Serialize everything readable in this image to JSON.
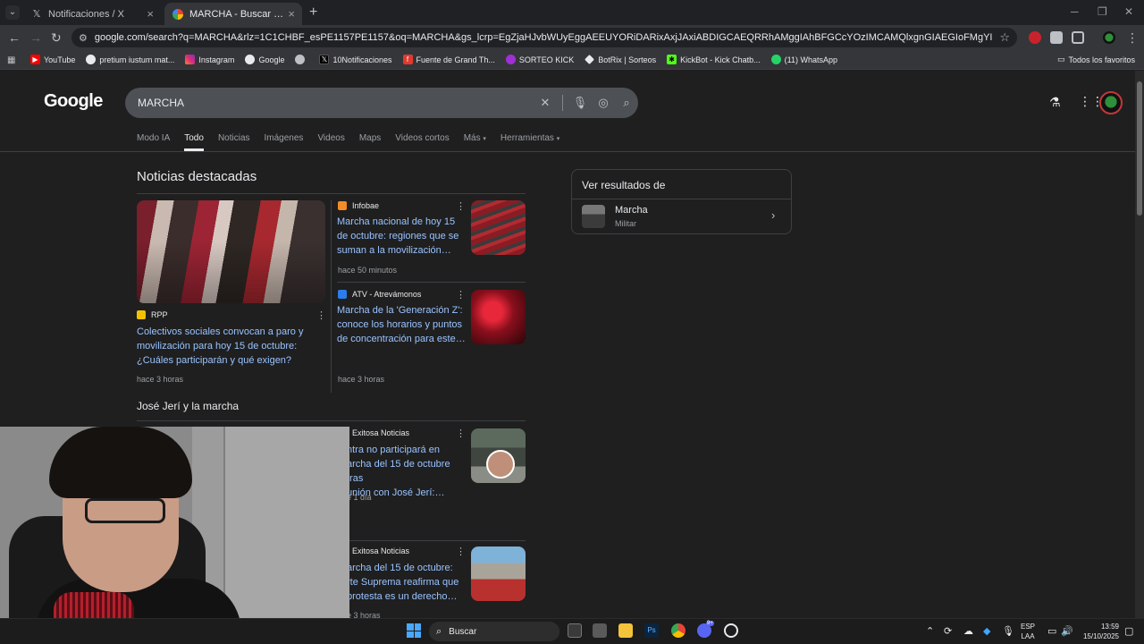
{
  "browser": {
    "tabs": [
      {
        "title": "Notificaciones / X",
        "active": false
      },
      {
        "title": "MARCHA - Buscar con Google",
        "active": true
      }
    ],
    "url": "google.com/search?q=MARCHA&rlz=1C1CHBF_esPE1157PE1157&oq=MARCHA&gs_lcrp=EgZjaHJvbWUyEggAEEUYORiDARixAxjJAxiABDIGCAEQRRhAMggIAhBFGCcYOzIMCAMQlxgnGIAEGIoFMgYIBBAAGAMyBggFEEUYPTIGCAYQRRg9MgYIBx...",
    "bookmarks": [
      "YouTube",
      "pretium iustum mat...",
      "Instagram",
      "Google",
      "",
      "10Notificaciones",
      "Fuente de Grand Th...",
      "SORTEO KICK",
      "BotRix | Sorteos",
      "KickBot - Kick Chatb...",
      "(11) WhatsApp"
    ],
    "bookmarks_all": "Todos los favoritos"
  },
  "google": {
    "logo": "Google",
    "query": "MARCHA",
    "nav_tabs": [
      "Modo IA",
      "Todo",
      "Noticias",
      "Imágenes",
      "Videos",
      "Maps",
      "Videos cortos",
      "Más",
      "Herramientas"
    ],
    "top_stories_title": "Noticias destacadas",
    "top_stories": [
      {
        "source": "RPP",
        "headline_l1": "Colectivos sociales convocan a paro y",
        "headline_l2": "movilización para hoy 15 de octubre:",
        "headline_l3": "¿Cuáles participarán y qué exigen?",
        "time": "hace 3 horas"
      },
      {
        "source": "Infobae",
        "headline_l1": "Marcha nacional de hoy 15",
        "headline_l2": "de octubre: regiones que se",
        "headline_l3": "suman a la movilización…",
        "time": "hace 50 minutos"
      },
      {
        "source": "ATV - Atrevámonos",
        "headline_l1": "Marcha de la 'Generación Z':",
        "headline_l2": "conoce los horarios y puntos",
        "headline_l3": "de concentración para este…",
        "time": "hace 3 horas"
      }
    ],
    "second_section_title": "José Jerí y la marcha",
    "second_stories": [
      {
        "source": "Exitosa Noticias",
        "headline_l1": "ntra no participará en",
        "headline_l2": "archa del 15 de octubre tras",
        "headline_l3": "unión con José Jerí:…",
        "time": "e 1 día"
      },
      {
        "source": "Exitosa Noticias",
        "headline_l1": "archa del 15 de octubre:",
        "headline_l2": "rte Suprema reafirma que",
        "headline_l3": "protesta es un derecho…",
        "time": "e 3 horas"
      }
    ],
    "knowledge_panel": {
      "title": "Ver resultados de",
      "name": "Marcha",
      "subtitle": "Militar"
    }
  },
  "taskbar": {
    "search_placeholder": "Buscar",
    "lang_l1": "ESP",
    "lang_l2": "LAA",
    "time": "13:59",
    "date": "15/10/2025",
    "badge": "9+"
  }
}
